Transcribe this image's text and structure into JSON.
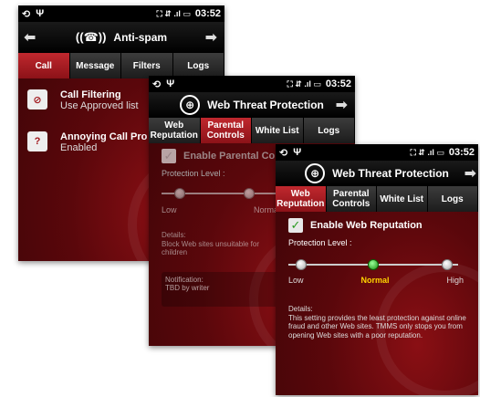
{
  "statusbar": {
    "sync": "⟲",
    "usb": "Ψ",
    "icons": "⛶ ⇵ .ıl ▭",
    "time": "03:52"
  },
  "phone1": {
    "title": "Anti-spam",
    "tabs": [
      "Call",
      "Message",
      "Filters",
      "Logs"
    ],
    "rows": [
      {
        "title": "Call Filtering",
        "subtitle": "Use Approved list"
      },
      {
        "title": "Annoying Call Pro",
        "subtitle": "Enabled"
      }
    ]
  },
  "phone2": {
    "title": "Web Threat Protection",
    "tabs": [
      "Web Reputation",
      "Parental Controls",
      "White List",
      "Logs"
    ],
    "enable_label": "Enable Parental Con",
    "protection_label": "Protection Level :",
    "levels": [
      "Low",
      "Normal"
    ],
    "details": "Details:\nBlock Web sites unsuitable for children",
    "notification": "Notification:\nTBD by writer"
  },
  "phone3": {
    "title": "Web Threat Protection",
    "tabs": [
      "Web Reputation",
      "Parental Controls",
      "White List",
      "Logs"
    ],
    "enable_label": "Enable Web Reputation",
    "protection_label": "Protection Level :",
    "levels": [
      "Low",
      "Normal",
      "High"
    ],
    "selected_level": "Normal",
    "details": "Details:\nThis setting provides the least protection against online fraud and other Web sites. TMMS only stops you from opening Web sites with a poor reputation."
  }
}
